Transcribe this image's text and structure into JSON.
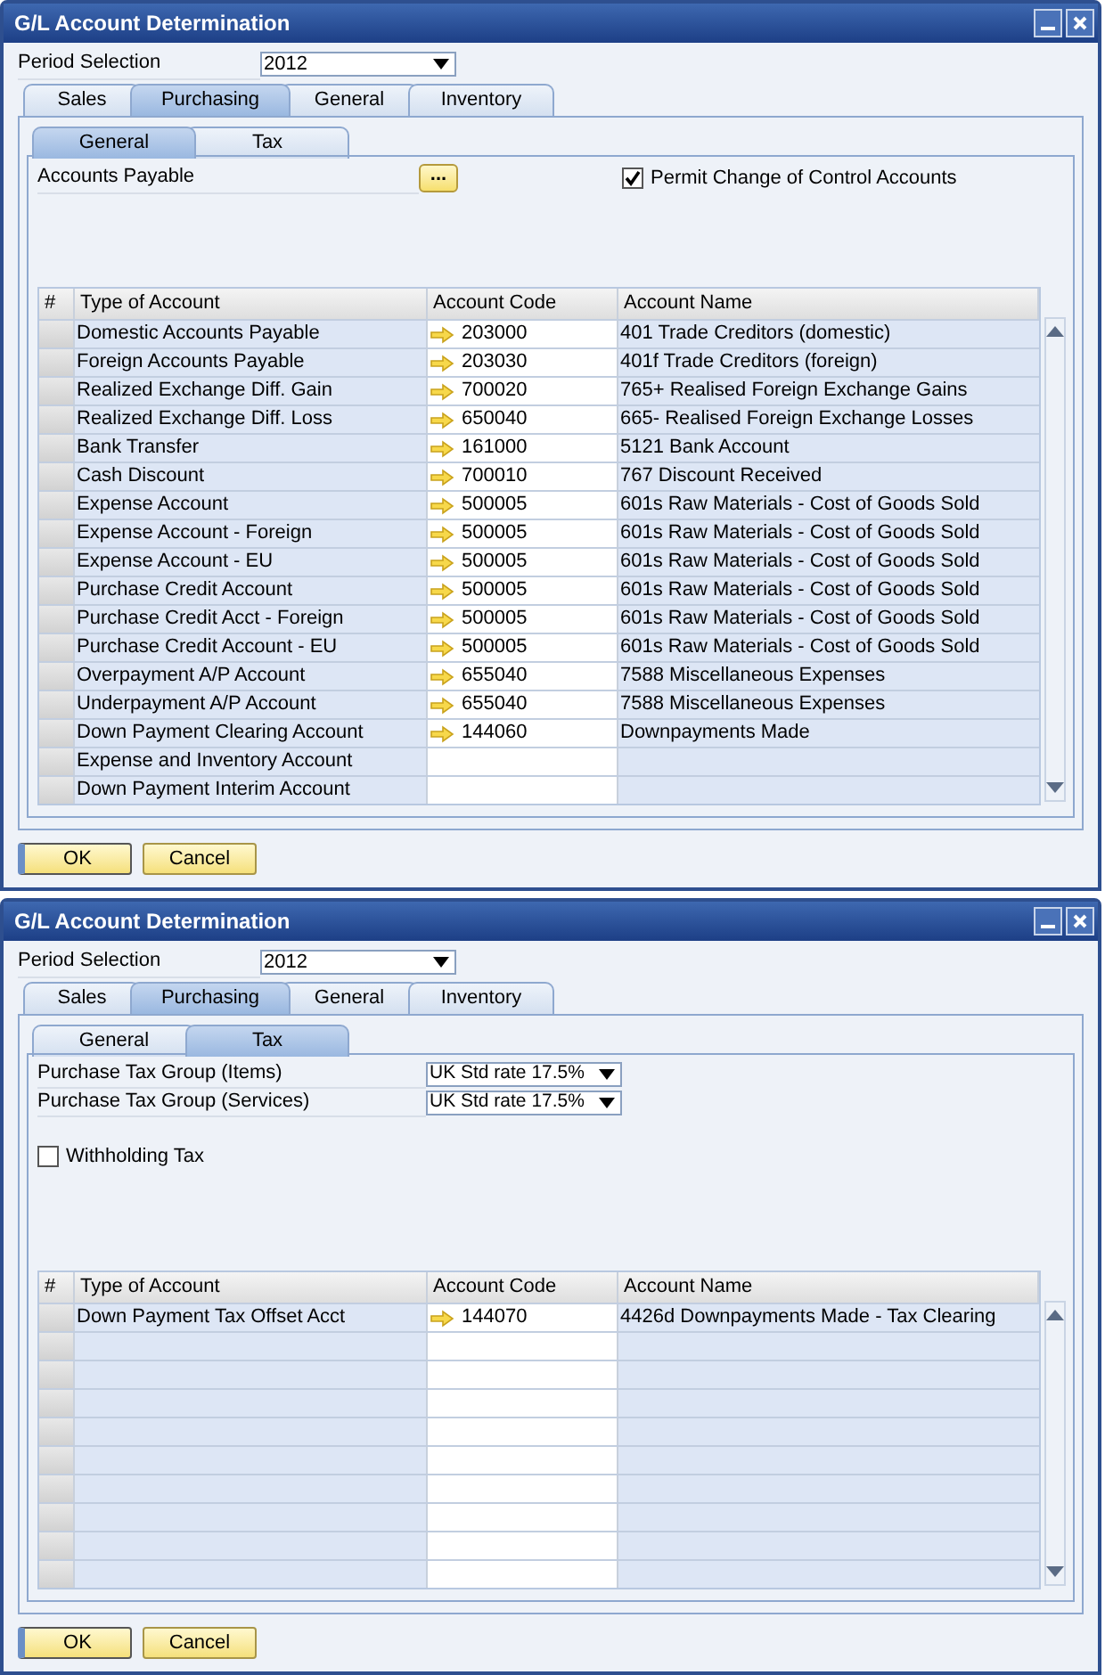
{
  "windows": [
    {
      "title": "G/L Account Determination",
      "period": {
        "label": "Period Selection",
        "value": "2012"
      },
      "tabs": [
        {
          "label": "Sales",
          "selected": false
        },
        {
          "label": "Purchasing",
          "selected": true
        },
        {
          "label": "General",
          "selected": false
        },
        {
          "label": "Inventory",
          "selected": false
        }
      ],
      "subtabs": [
        {
          "label": "General",
          "selected": true
        },
        {
          "label": "Tax",
          "selected": false
        }
      ],
      "fields": [
        {
          "kind": "browse",
          "label": "Accounts Payable",
          "button": "..."
        }
      ],
      "checkboxes": [
        {
          "label": "Permit Change of Control Accounts",
          "checked": true
        }
      ],
      "table": {
        "columns": [
          "#",
          "Type of Account",
          "Account Code",
          "Account Name"
        ],
        "rows": [
          {
            "type": "Domestic Accounts Payable",
            "code": "203000",
            "name": "401 Trade Creditors (domestic)"
          },
          {
            "type": "Foreign Accounts Payable",
            "code": "203030",
            "name": "401f Trade Creditors (foreign)"
          },
          {
            "type": "Realized Exchange Diff. Gain",
            "code": "700020",
            "name": "765+ Realised Foreign Exchange Gains"
          },
          {
            "type": "Realized Exchange Diff. Loss",
            "code": "650040",
            "name": "665- Realised Foreign Exchange Losses"
          },
          {
            "type": "Bank Transfer",
            "code": "161000",
            "name": "5121 Bank Account"
          },
          {
            "type": "Cash Discount",
            "code": "700010",
            "name": "767 Discount Received"
          },
          {
            "type": "Expense Account",
            "code": "500005",
            "name": "601s Raw Materials - Cost of Goods Sold"
          },
          {
            "type": "Expense Account - Foreign",
            "code": "500005",
            "name": "601s Raw Materials - Cost of Goods Sold"
          },
          {
            "type": "Expense Account - EU",
            "code": "500005",
            "name": "601s Raw Materials - Cost of Goods Sold"
          },
          {
            "type": "Purchase Credit Account",
            "code": "500005",
            "name": "601s Raw Materials - Cost of Goods Sold"
          },
          {
            "type": "Purchase Credit Acct - Foreign",
            "code": "500005",
            "name": "601s Raw Materials - Cost of Goods Sold"
          },
          {
            "type": "Purchase Credit Account - EU",
            "code": "500005",
            "name": "601s Raw Materials - Cost of Goods Sold"
          },
          {
            "type": "Overpayment A/P Account",
            "code": "655040",
            "name": "7588 Miscellaneous Expenses"
          },
          {
            "type": "Underpayment A/P Account",
            "code": "655040",
            "name": "7588 Miscellaneous Expenses"
          },
          {
            "type": "Down Payment Clearing Account",
            "code": "144060",
            "name": "Downpayments Made"
          },
          {
            "type": "Expense and Inventory Account"
          },
          {
            "type": "Down Payment Interim Account"
          }
        ]
      },
      "buttons": [
        "OK",
        "Cancel"
      ]
    },
    {
      "title": "G/L Account Determination",
      "period": {
        "label": "Period Selection",
        "value": "2012"
      },
      "tabs": [
        {
          "label": "Sales",
          "selected": false
        },
        {
          "label": "Purchasing",
          "selected": true
        },
        {
          "label": "General",
          "selected": false
        },
        {
          "label": "Inventory",
          "selected": false
        }
      ],
      "subtabs": [
        {
          "label": "General",
          "selected": false
        },
        {
          "label": "Tax",
          "selected": true
        }
      ],
      "fields": [
        {
          "kind": "dropdown",
          "label": "Purchase Tax Group (Items)",
          "value": "UK Std rate 17.5%"
        },
        {
          "kind": "dropdown",
          "label": "Purchase Tax Group (Services)",
          "value": "UK Std rate 17.5%"
        }
      ],
      "checkboxes": [
        {
          "label": "Withholding Tax",
          "checked": false
        }
      ],
      "table": {
        "columns": [
          "#",
          "Type of Account",
          "Account Code",
          "Account Name"
        ],
        "rows": [
          {
            "type": "Down Payment Tax Offset Acct",
            "code": "144070",
            "name": "4426d Downpayments Made - Tax Clearing"
          },
          {},
          {},
          {},
          {},
          {},
          {},
          {},
          {},
          {}
        ]
      },
      "buttons": [
        "OK",
        "Cancel"
      ]
    }
  ]
}
